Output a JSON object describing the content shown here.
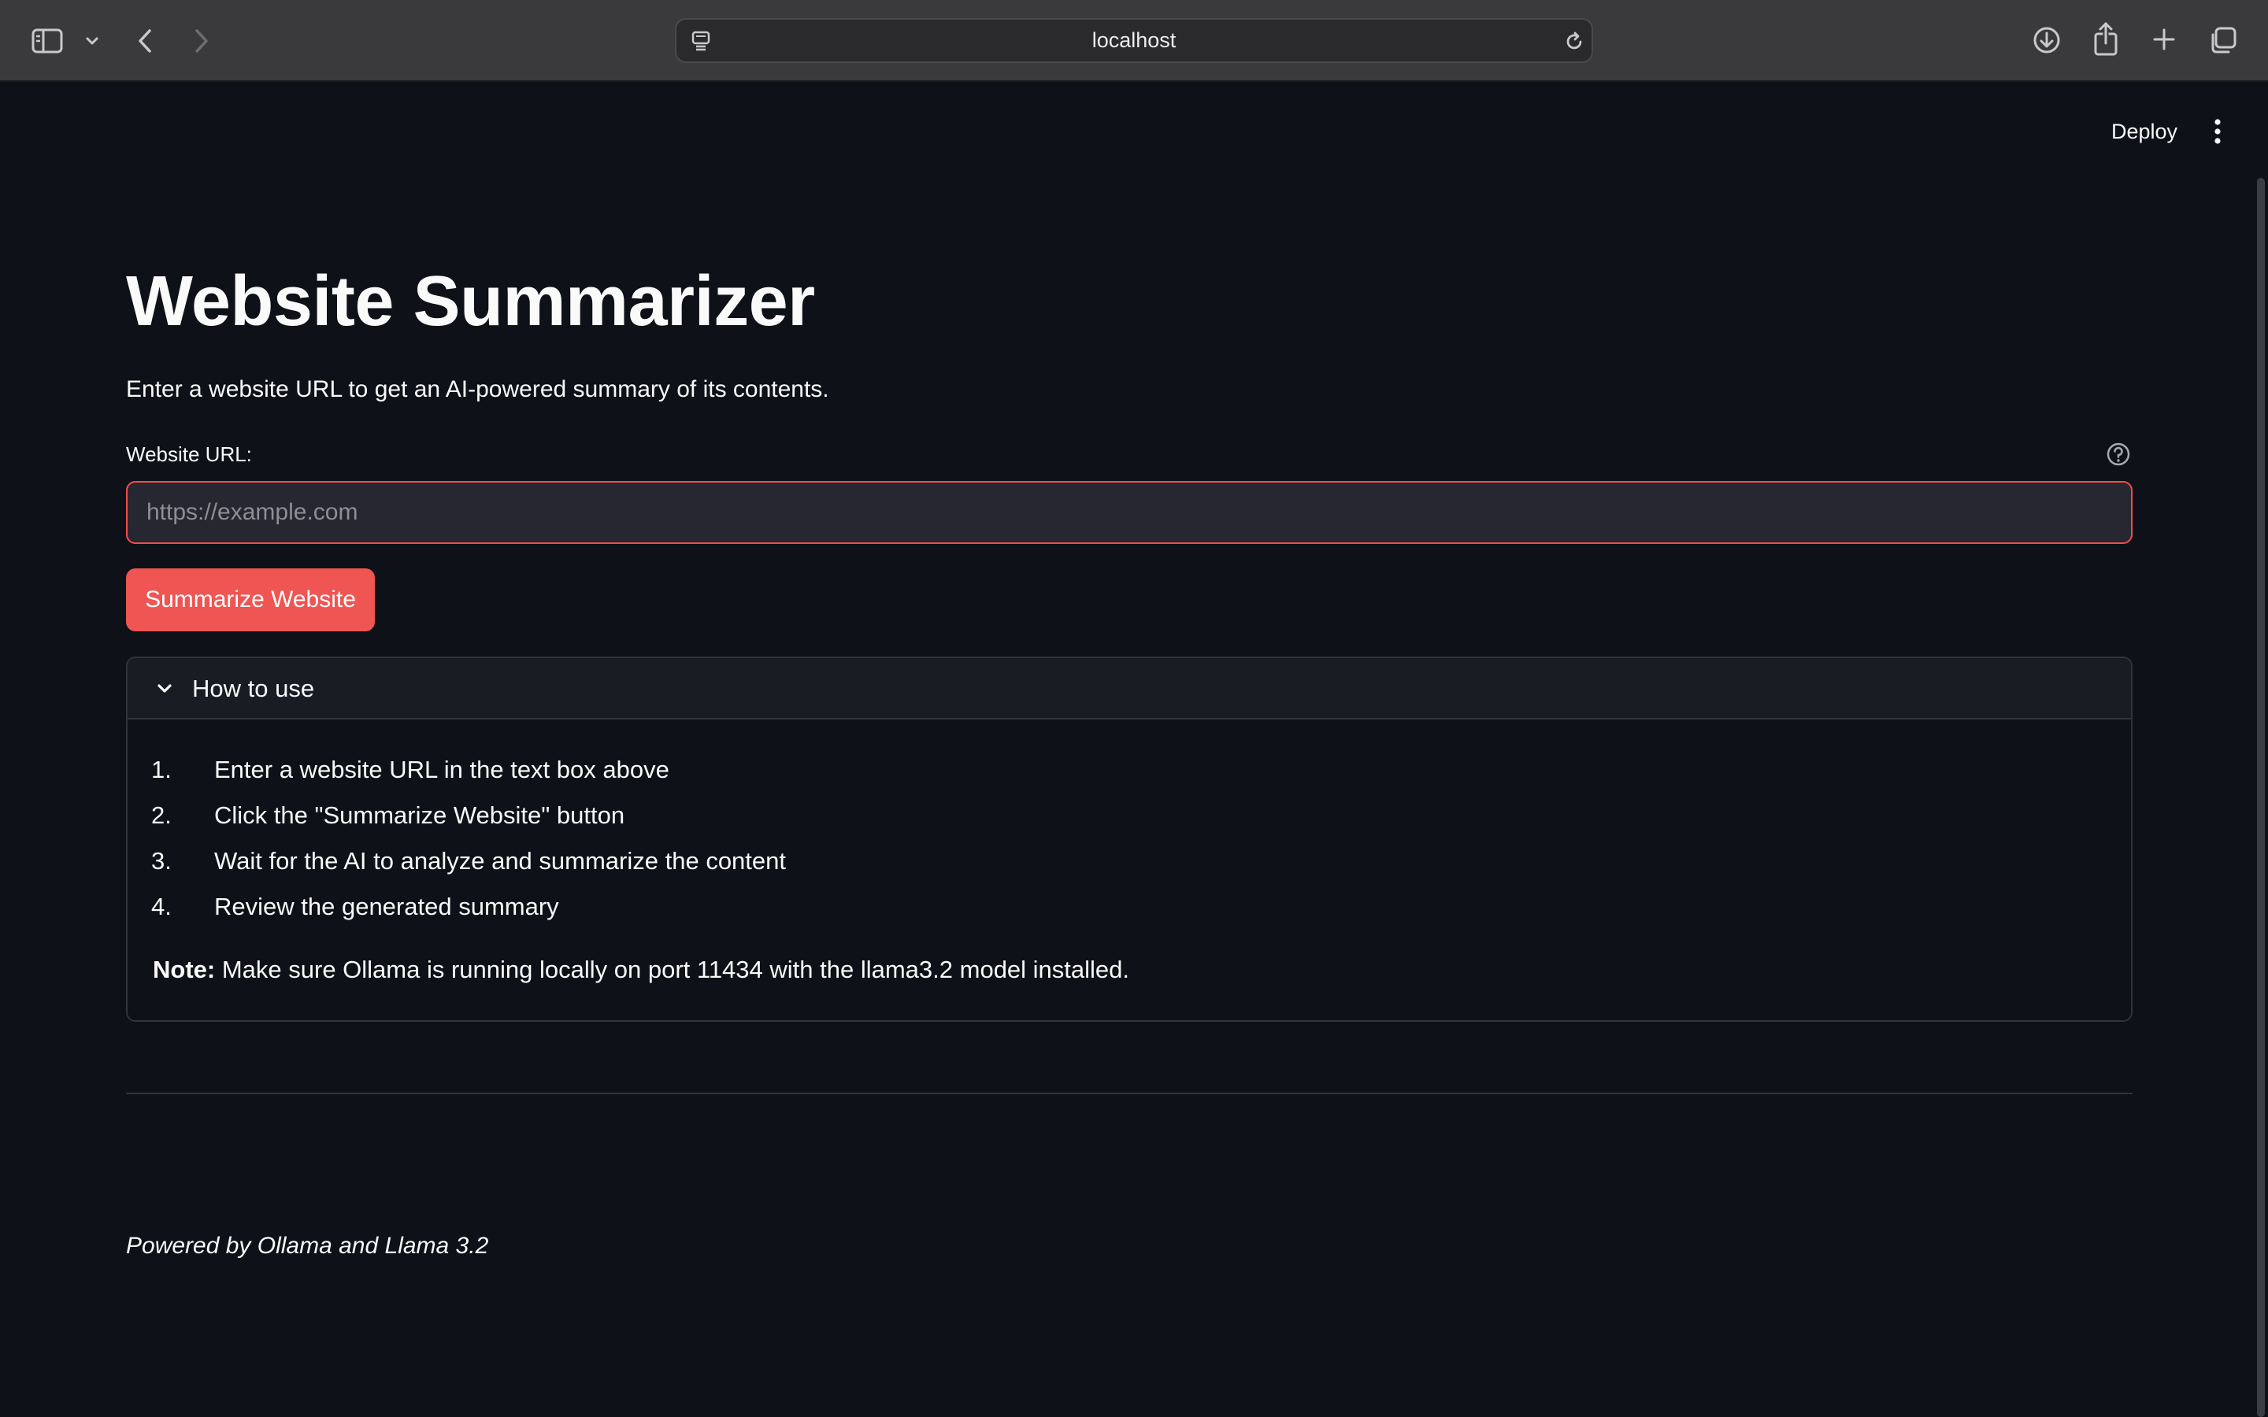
{
  "browser": {
    "address": "localhost"
  },
  "app_header": {
    "deploy_label": "Deploy"
  },
  "main": {
    "title": "Website Summarizer",
    "subtitle": "Enter a website URL to get an AI-powered summary of its contents.",
    "url_field": {
      "label": "Website URL:",
      "value": "",
      "placeholder": "https://example.com"
    },
    "submit_label": "Summarize Website",
    "how_to": {
      "title": "How to use",
      "steps": [
        {
          "num": "1.",
          "text": "Enter a website URL in the text box above"
        },
        {
          "num": "2.",
          "text": "Click the \"Summarize Website\" button"
        },
        {
          "num": "3.",
          "text": "Wait for the AI to analyze and summarize the content"
        },
        {
          "num": "4.",
          "text": "Review the generated summary"
        }
      ],
      "note_label": "Note:",
      "note_text": " Make sure Ollama is running locally on port 11434 with the llama3.2 model installed."
    },
    "footer": "Powered by Ollama and Llama 3.2"
  },
  "colors": {
    "background": "#0e1117",
    "accent": "#ef5552",
    "input_border": "#ff4b4b",
    "text": "#fafafa"
  },
  "icons": {
    "toolbar": [
      "sidebar-icon",
      "chevron-down-icon",
      "back-icon",
      "forward-icon",
      "page-menu-icon",
      "reload-icon",
      "download-icon",
      "share-icon",
      "new-tab-icon",
      "tab-overview-icon"
    ],
    "app": [
      "more-vert-icon",
      "help-circle-icon",
      "chevron-down-icon"
    ]
  }
}
